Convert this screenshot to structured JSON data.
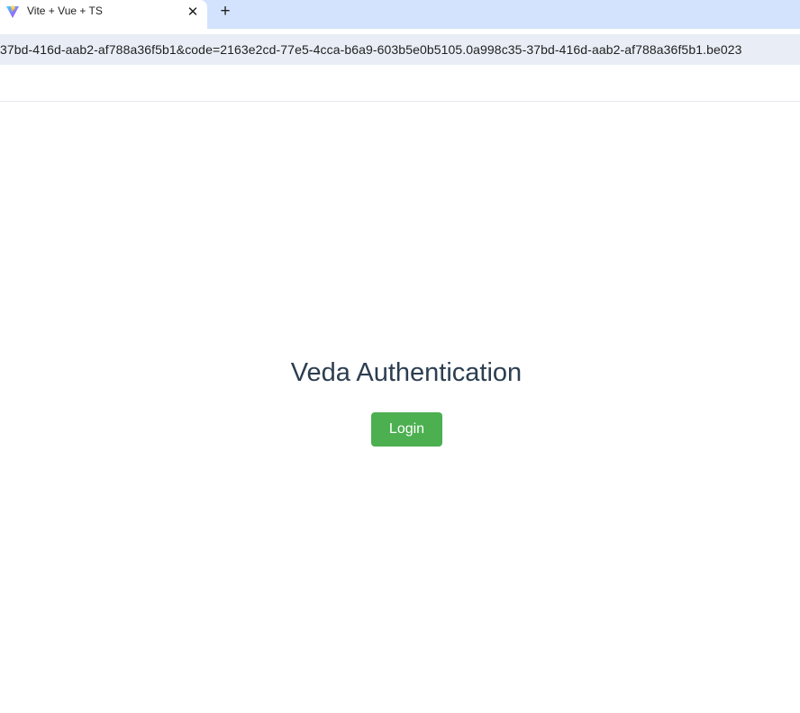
{
  "browser": {
    "tab": {
      "title": "Vite + Vue + TS",
      "favicon": "vite-logo-icon",
      "close_glyph": "✕"
    },
    "new_tab_glyph": "+",
    "address_bar": {
      "url": "37bd-416d-aab2-af788a36f5b1&code=2163e2cd-77e5-4cca-b6a9-603b5e0b5105.0a998c35-37bd-416d-aab2-af788a36f5b1.be023"
    }
  },
  "page": {
    "heading": "Veda Authentication",
    "login_button_label": "Login"
  },
  "colors": {
    "tabstrip_bg": "#d3e3fd",
    "omnibox_bg": "#e9eef6",
    "heading_text": "#2c3e50",
    "button_bg": "#4caf50",
    "button_text": "#ffffff"
  }
}
